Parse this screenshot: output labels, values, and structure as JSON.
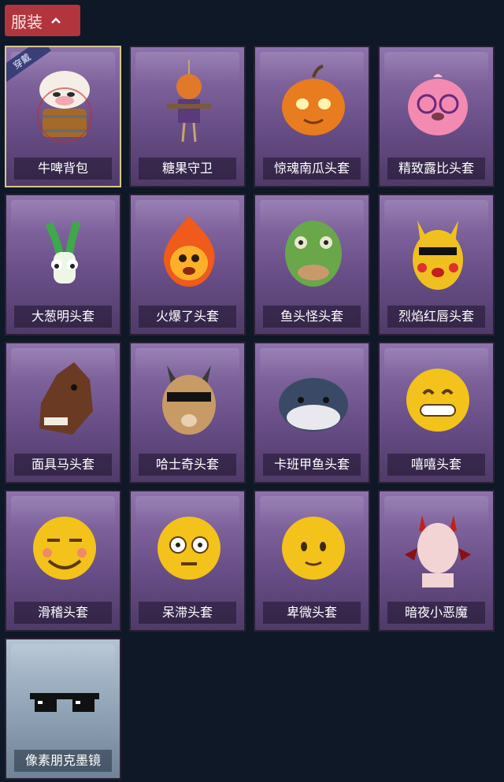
{
  "header": {
    "title": "服装"
  },
  "items": [
    {
      "name": "牛啤背包",
      "icon": "cow-beer-barrel-icon",
      "equipped": true,
      "badge": "穿戴"
    },
    {
      "name": "糖果守卫",
      "icon": "scarecrow-icon"
    },
    {
      "name": "惊魂南瓜头套",
      "icon": "pumpkin-icon"
    },
    {
      "name": "精致露比头套",
      "icon": "pink-beaver-glasses-icon"
    },
    {
      "name": "大葱明头套",
      "icon": "green-onion-icon"
    },
    {
      "name": "火爆了头套",
      "icon": "fireball-icon"
    },
    {
      "name": "鱼头怪头套",
      "icon": "fish-head-mask-icon"
    },
    {
      "name": "烈焰红唇头套",
      "icon": "pikachu-mask-icon"
    },
    {
      "name": "面具马头套",
      "icon": "horse-mask-icon"
    },
    {
      "name": "哈士奇头套",
      "icon": "husky-mask-icon"
    },
    {
      "name": "卡班甲鱼头套",
      "icon": "whale-head-icon"
    },
    {
      "name": "嘻嘻头套",
      "icon": "grin-emoji-icon"
    },
    {
      "name": "滑稽头套",
      "icon": "funny-emoji-icon"
    },
    {
      "name": "呆滞头套",
      "icon": "dazed-emoji-icon"
    },
    {
      "name": "卑微头套",
      "icon": "humble-emoji-icon"
    },
    {
      "name": "暗夜小恶魔",
      "icon": "devil-mask-icon"
    },
    {
      "name": "像素朋克墨镜",
      "icon": "pixel-sunglasses-icon",
      "silver": true
    }
  ]
}
